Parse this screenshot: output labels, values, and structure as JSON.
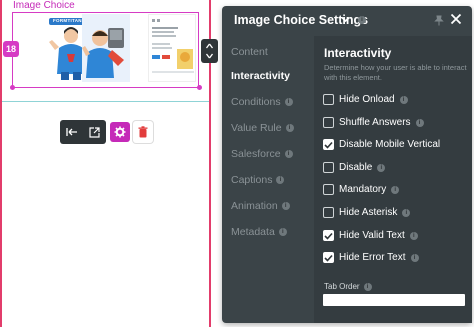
{
  "canvas": {
    "element_label": "Image Choice",
    "badge_number": "18",
    "thumb1_logo": "FORMTITAN"
  },
  "panel": {
    "title": "Image Choice Settings",
    "nav": [
      {
        "label": "Content",
        "active": false,
        "info": false
      },
      {
        "label": "Interactivity",
        "active": true,
        "info": false
      },
      {
        "label": "Conditions",
        "active": false,
        "info": true
      },
      {
        "label": "Value Rule",
        "active": false,
        "info": true
      },
      {
        "label": "Salesforce",
        "active": false,
        "info": true
      },
      {
        "label": "Captions",
        "active": false,
        "info": true
      },
      {
        "label": "Animation",
        "active": false,
        "info": true
      },
      {
        "label": "Metadata",
        "active": false,
        "info": true
      }
    ],
    "section_title": "Interactivity",
    "section_desc": "Determine how your user is able to interact with this element.",
    "options": [
      {
        "label": "Hide Onload",
        "checked": false
      },
      {
        "label": "Shuffle Answers",
        "checked": false
      },
      {
        "label": "Disable Mobile Vertical",
        "checked": true
      },
      {
        "label": "Disable",
        "checked": false
      },
      {
        "label": "Mandatory",
        "checked": false
      },
      {
        "label": "Hide Asterisk",
        "checked": false
      },
      {
        "label": "Hide Valid Text",
        "checked": true
      },
      {
        "label": "Hide Error Text",
        "checked": true
      }
    ],
    "tab_order_label": "Tab Order",
    "tab_order_value": ""
  },
  "colors": {
    "accent": "#c52ab8",
    "panel_bg": "#3b4448",
    "border_red": "#e23c6b"
  }
}
